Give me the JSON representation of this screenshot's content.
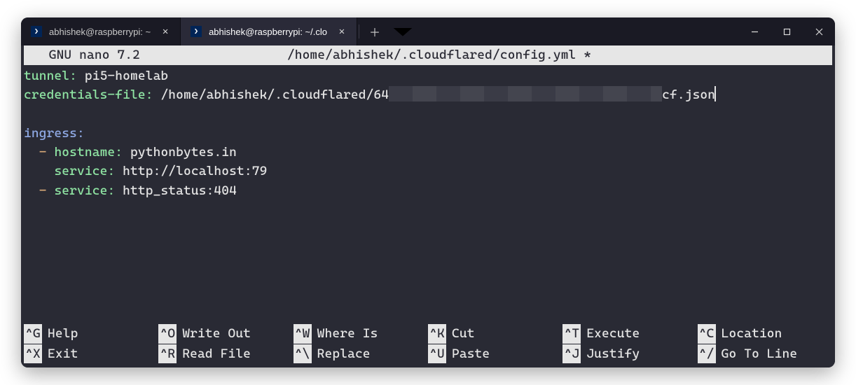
{
  "tabs": [
    {
      "label": "abhishek@raspberrypi: ~",
      "active": false
    },
    {
      "label": "abhishek@raspberrypi: ~/.clo",
      "active": true
    }
  ],
  "nano": {
    "title": "  GNU nano 7.2",
    "filepath": "/home/abhishek/.cloudflared/config.yml *"
  },
  "file": {
    "tunnel_key": "tunnel",
    "tunnel_val": "pi5-homelab",
    "cred_key": "credentials-file",
    "cred_prefix": "/home/abhishek/.cloudflared/64",
    "cred_suffix": "cf.json",
    "ingress_key": "ingress",
    "hostname_key": "hostname",
    "hostname_val": "pythonbytes.in",
    "service_key": "service",
    "service1_val": "http://localhost:79",
    "service2_val": "http_status:404"
  },
  "shortcuts": [
    {
      "key": "^G",
      "label": "Help"
    },
    {
      "key": "^O",
      "label": "Write Out"
    },
    {
      "key": "^W",
      "label": "Where Is"
    },
    {
      "key": "^K",
      "label": "Cut"
    },
    {
      "key": "^T",
      "label": "Execute"
    },
    {
      "key": "^C",
      "label": "Location"
    },
    {
      "key": "^X",
      "label": "Exit"
    },
    {
      "key": "^R",
      "label": "Read File"
    },
    {
      "key": "^\\",
      "label": "Replace"
    },
    {
      "key": "^U",
      "label": "Paste"
    },
    {
      "key": "^J",
      "label": "Justify"
    },
    {
      "key": "^/",
      "label": "Go To Line"
    }
  ]
}
